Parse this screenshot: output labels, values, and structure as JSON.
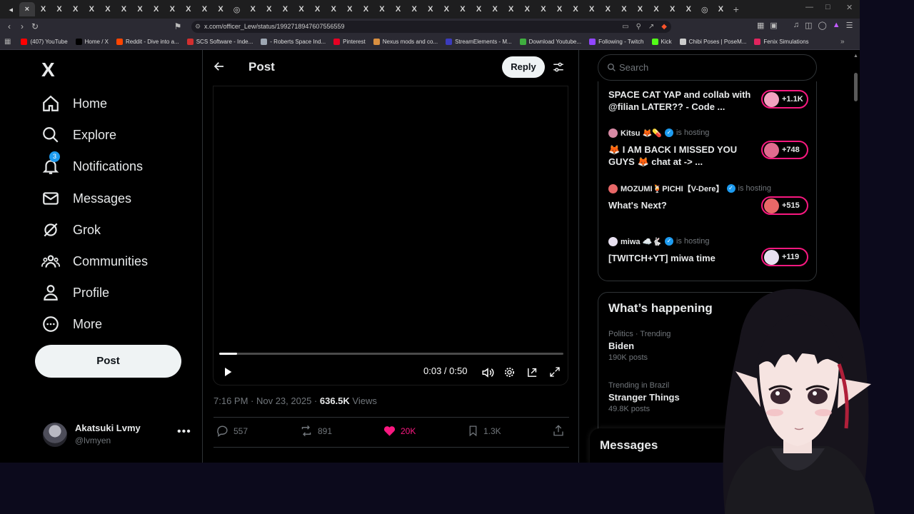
{
  "browser": {
    "url": "x.com/officer_Lew/status/1992718947607556559",
    "tab_count": 45,
    "bookmarks": [
      {
        "label": "(407) YouTube",
        "color": "#ff0000"
      },
      {
        "label": "Home / X",
        "color": "#000000"
      },
      {
        "label": "Reddit - Dive into a...",
        "color": "#ff4500"
      },
      {
        "label": "SCS Software - Inde...",
        "color": "#d32f2f"
      },
      {
        "label": "- Roberts Space Ind...",
        "color": "#9ea7b3"
      },
      {
        "label": "Pinterest",
        "color": "#e60023"
      },
      {
        "label": "Nexus mods and co...",
        "color": "#d98f40"
      },
      {
        "label": "StreamElements - M...",
        "color": "#3b3bbd"
      },
      {
        "label": "Download Youtube...",
        "color": "#3fae3f"
      },
      {
        "label": "Following - Twitch",
        "color": "#9146ff"
      },
      {
        "label": "Kick",
        "color": "#53fc18"
      },
      {
        "label": "Chibi Poses | PoseM...",
        "color": "#cccccc"
      },
      {
        "label": "Fenix Simulations",
        "color": "#e0245e"
      }
    ]
  },
  "nav": {
    "logo": "X",
    "items": [
      {
        "label": "Home",
        "icon": "home-icon"
      },
      {
        "label": "Explore",
        "icon": "search-icon"
      },
      {
        "label": "Notifications",
        "icon": "bell-icon",
        "badge": "3"
      },
      {
        "label": "Messages",
        "icon": "mail-icon"
      },
      {
        "label": "Grok",
        "icon": "grok-icon"
      },
      {
        "label": "Communities",
        "icon": "communities-icon"
      },
      {
        "label": "Profile",
        "icon": "person-icon"
      },
      {
        "label": "More",
        "icon": "more-circle-icon"
      }
    ],
    "post_button": "Post",
    "account": {
      "name": "Akatsuki Lvmy",
      "handle": "@lvmyen"
    }
  },
  "post": {
    "header_title": "Post",
    "reply_button": "Reply",
    "video": {
      "time": "0:03 / 0:50",
      "progress": 0.052
    },
    "timestamp": "7:16 PM · Nov 23, 2025 · ",
    "views_count": "636.5K",
    "views_label": " Views",
    "stats": {
      "replies": "557",
      "reposts": "891",
      "likes": "20K",
      "bookmarks": "1.3K"
    }
  },
  "sidebar": {
    "search_placeholder": "Search",
    "streams": [
      {
        "host": "",
        "title": "SPACE CAT YAP and collab with @filian LATER?? - Code ...",
        "count": "+1.1K",
        "color": "#f2a2c0"
      },
      {
        "host": "Kitsu 🦊💊",
        "hosting": "is hosting",
        "title": "🦊 I AM BACK I MISSED YOU GUYS 🦊 chat at -> ...",
        "count": "+748",
        "color": "#e06b8f"
      },
      {
        "host": "MOZUMI🍹PICHI【V-Dere】",
        "hosting": "is hosting",
        "title": "What's Next?",
        "count": "+515",
        "color": "#e86868"
      },
      {
        "host": "miwa ☁️🐇",
        "hosting": "is hosting",
        "title": "[TWITCH+YT] miwa time",
        "count": "+119",
        "color": "#e8e0f0"
      }
    ],
    "happening_title": "What’s happening",
    "trends": [
      {
        "category": "Politics · Trending",
        "name": "Biden",
        "count": "190K posts"
      },
      {
        "category": "Trending in Brazil",
        "name": "Stranger Things",
        "count": "49.8K posts"
      }
    ],
    "messages_label": "Messages"
  },
  "colors": {
    "accent": "#1d9bf0",
    "like": "#f91880",
    "background": "#000000"
  }
}
